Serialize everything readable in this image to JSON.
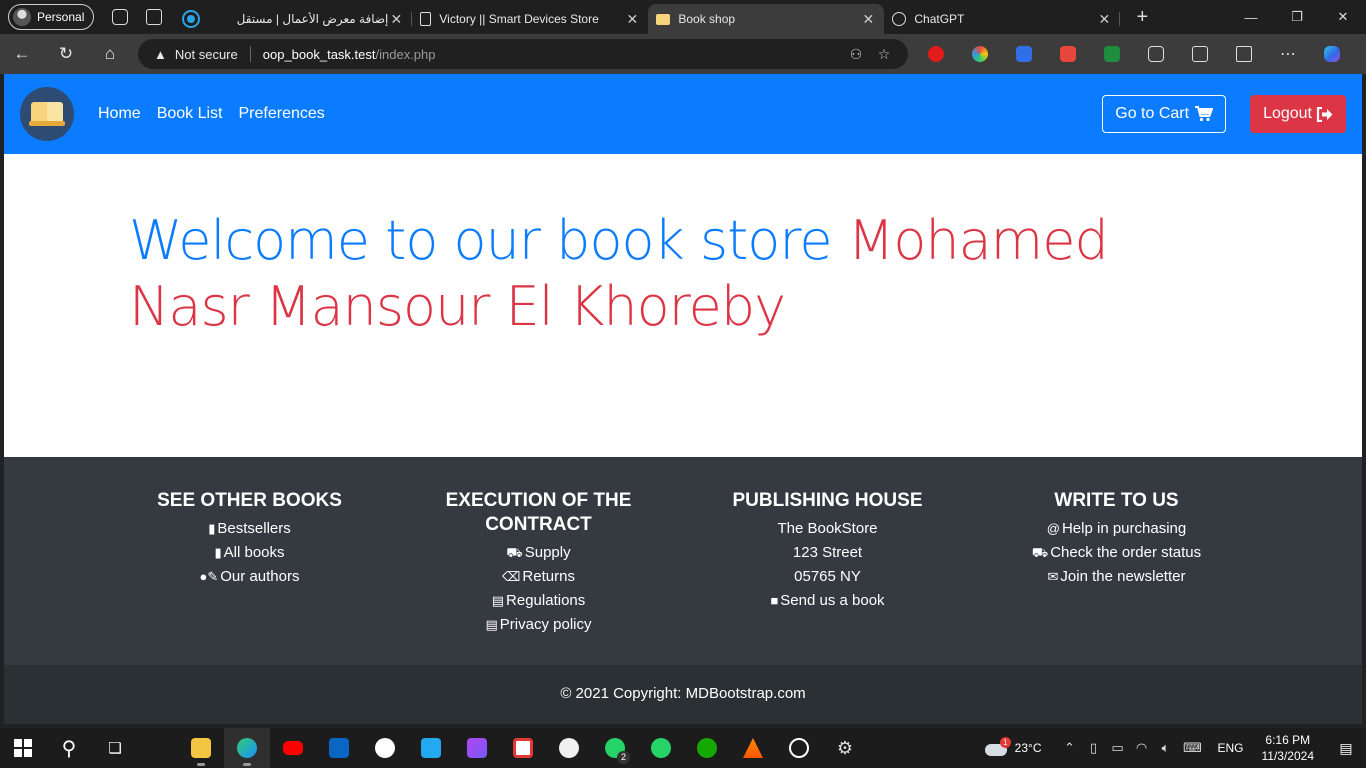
{
  "browser": {
    "profile_label": "Personal",
    "tabs": [
      {
        "title": "إضافة معرض الأعمال | مستقل",
        "icon": "mostaql-favicon-icon",
        "active": false
      },
      {
        "title": "Victory || Smart Devices Store",
        "icon": "document-icon",
        "active": false
      },
      {
        "title": "Book shop",
        "icon": "book-favicon-icon",
        "active": true
      },
      {
        "title": "ChatGPT",
        "icon": "chatgpt-favicon-icon",
        "active": false
      }
    ],
    "security_label": "Not secure",
    "url_host": "oop_book_task.test",
    "url_path": "/index.php"
  },
  "site": {
    "nav_links": [
      "Home",
      "Book List",
      "Preferences"
    ],
    "cart_label": "Go to Cart",
    "logout_label": "Logout",
    "welcome_text": "Welcome to our book store",
    "user_name": "Mohamed Nasr Mansour El Khoreby"
  },
  "footer": {
    "columns": [
      {
        "title": "See other books",
        "items": [
          {
            "label": "Bestsellers",
            "icon": "book-icon"
          },
          {
            "label": "All books",
            "icon": "book-icon"
          },
          {
            "label": "Our authors",
            "icon": "user-edit-icon"
          }
        ]
      },
      {
        "title": "Execution of the contract",
        "items": [
          {
            "label": "Supply",
            "icon": "truck-icon"
          },
          {
            "label": "Returns",
            "icon": "backspace-icon"
          },
          {
            "label": "Regulations",
            "icon": "file-icon"
          },
          {
            "label": "Privacy policy",
            "icon": "file-icon"
          }
        ]
      },
      {
        "title": "Publishing house",
        "items": [
          {
            "label": "The BookStore",
            "icon": ""
          },
          {
            "label": "123 Street",
            "icon": ""
          },
          {
            "label": "05765 NY",
            "icon": ""
          },
          {
            "label": "Send us a book",
            "icon": "briefcase-icon"
          }
        ]
      },
      {
        "title": "Write to us",
        "items": [
          {
            "label": "Help in purchasing",
            "icon": "at-icon"
          },
          {
            "label": "Check the order status",
            "icon": "truck-icon"
          },
          {
            "label": "Join the newsletter",
            "icon": "envelope-icon"
          }
        ]
      }
    ],
    "copyright": "© 2021 Copyright: MDBootstrap.com"
  },
  "taskbar": {
    "temperature": "23°C",
    "language": "ENG",
    "time": "6:16 PM",
    "date": "11/3/2024",
    "whatsapp_badge": "2",
    "weather_badge": "1"
  },
  "colors": {
    "primary": "#0b7bff",
    "danger": "#dc3545",
    "footer_bg": "#343a40",
    "copyright_bg": "#2b3035"
  }
}
